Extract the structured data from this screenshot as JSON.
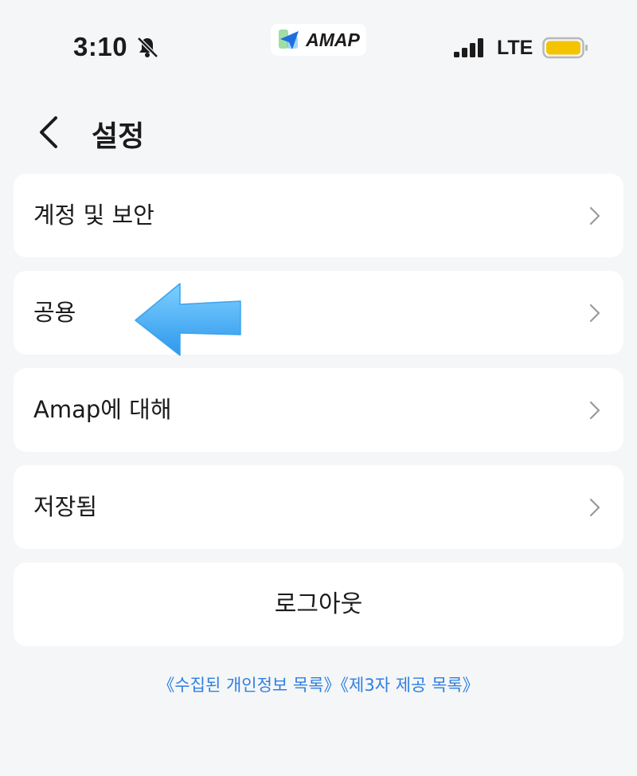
{
  "status_bar": {
    "time": "3:10",
    "app_name": "AMAP",
    "network": "LTE",
    "icons": [
      "bell-slash-icon",
      "amap-logo-icon",
      "signal-bars-icon",
      "battery-icon"
    ],
    "battery_color": "#f5c400"
  },
  "header": {
    "back_icon": "chevron-left-icon",
    "title": "설정"
  },
  "menu": {
    "items": [
      {
        "label": "계정 및 보안",
        "icon": "chevron-right-icon"
      },
      {
        "label": "공용",
        "icon": "chevron-right-icon"
      },
      {
        "label": "Amap에 대해",
        "icon": "chevron-right-icon"
      },
      {
        "label": "저장됨",
        "icon": "chevron-right-icon"
      }
    ],
    "logout_label": "로그아웃"
  },
  "annotation": {
    "icon": "left-arrow-icon",
    "color": "#4ab0f5"
  },
  "footer": {
    "link_1": "《수집된 개인정보 목록》",
    "link_2": "《제3자 제공 목록》",
    "link_color": "#2f7fe0"
  },
  "colors": {
    "background": "#f5f6f8",
    "card": "#ffffff",
    "text": "#1b1b1b",
    "chevron": "#9a9a9a"
  }
}
